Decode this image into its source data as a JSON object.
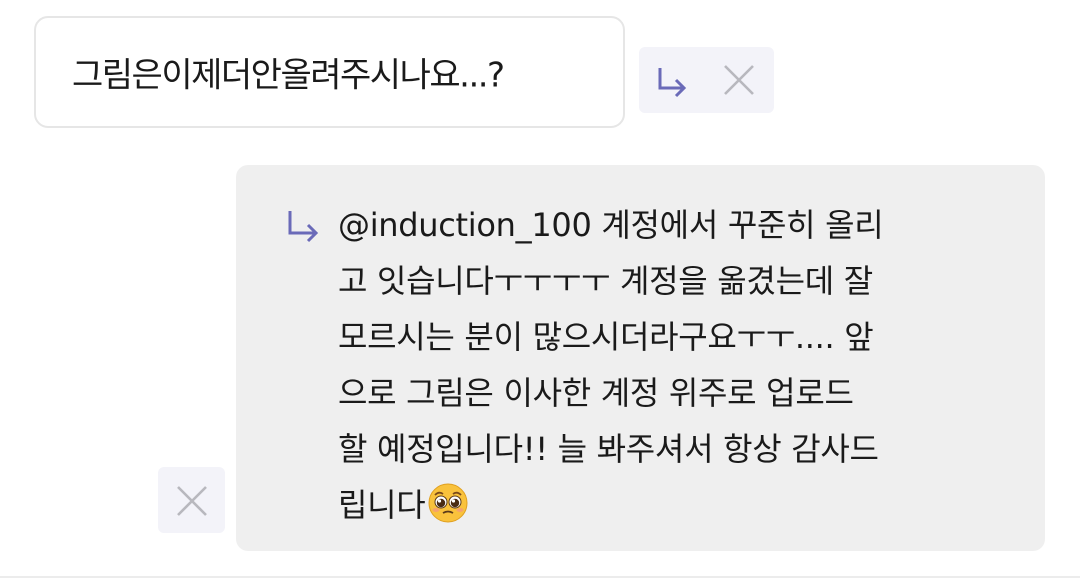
{
  "incoming_message": {
    "text": "그림은이제더안올려주시나요...?"
  },
  "outgoing_reply": {
    "lines": [
      "@induction_100 계정에서 꾸준히 올리",
      "고 잇습니다ㅜㅜㅜㅜ 계정을 옮겼는데 잘",
      "모르시는 분이 많으시더라구요ㅜㅜ.... 앞",
      "으로 그림은 이사한 계정 위주로 업로드",
      "할 예정입니다!! 늘 봐주셔서 항상 감사드",
      "립니다"
    ],
    "trailing_emoji": "pleading-face-emoji"
  },
  "icons": {
    "reply": "reply-arrow-icon",
    "close": "close-icon"
  },
  "colors": {
    "reply_arrow": "#6a6ab8",
    "close_x": "#b8b8be",
    "action_bg": "#f3f3f9",
    "reply_bubble_bg": "#efefef",
    "incoming_border": "#e6e6e6"
  }
}
